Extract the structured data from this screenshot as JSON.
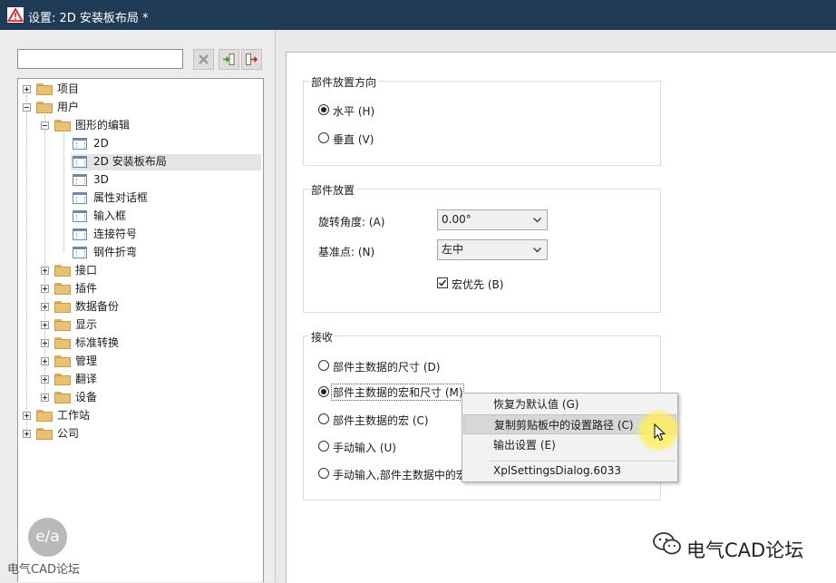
{
  "window": {
    "title": "设置: 2D 安装板布局 *"
  },
  "search": {
    "placeholder": ""
  },
  "tree": {
    "n0": "项目",
    "n1": "用户",
    "n2": "图形的编辑",
    "n3": "2D",
    "n4": "2D 安装板布局",
    "n5": "3D",
    "n6": "属性对话框",
    "n7": "输入框",
    "n8": "连接符号",
    "n9": "钢件折弯",
    "n10": "接口",
    "n11": "插件",
    "n12": "数据备份",
    "n13": "显示",
    "n14": "标准转换",
    "n15": "管理",
    "n16": "翻译",
    "n17": "设备",
    "n18": "工作站",
    "n19": "公司"
  },
  "orientation": {
    "title": "部件放置方向",
    "horizontal": "水平 (H)",
    "vertical": "垂直 (V)",
    "selected": "horizontal"
  },
  "placement": {
    "title": "部件放置",
    "rotation_label": "旋转角度: (A)",
    "rotation_value": "0.00°",
    "base_label": "基准点: (N)",
    "base_value": "左中",
    "macro_first": "宏优先 (B)",
    "macro_first_checked": true
  },
  "receive": {
    "title": "接收",
    "o1": "部件主数据的尺寸 (D)",
    "o2": "部件主数据的宏和尺寸 (M)",
    "o3": "部件主数据的宏 (C)",
    "o4": "手动输入  (U)",
    "o5": "手动输入,部件主数据中的宏",
    "selected": "o2"
  },
  "context_menu": {
    "restore_default": "恢复为默认值 (G)",
    "copy_path": "复制剪贴板中的设置路径 (C)",
    "export": "输出设置 (E)",
    "dialog_id": "XplSettingsDialog.6033"
  },
  "watermark": {
    "left": "电气CAD论坛",
    "right": "电气CAD论坛",
    "logo": "e/a"
  },
  "colors": {
    "titlebar": "#1f3b56",
    "warning_icon": "#e02020"
  },
  "icons": [
    "warning-icon",
    "clear-icon",
    "import-icon",
    "export-icon",
    "folder-icon",
    "settings-page-icon",
    "chevron-down-icon",
    "checkmark-icon",
    "cursor-icon"
  ]
}
